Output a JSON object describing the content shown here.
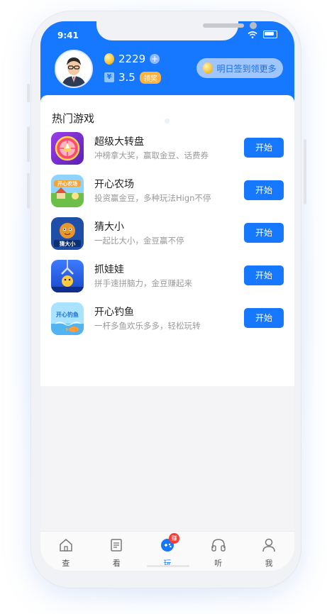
{
  "status_bar": {
    "time": "9:41"
  },
  "user": {
    "coins": "2229",
    "money": "3.5",
    "money_icon": "¥",
    "claim_label": "领奖",
    "signin_label": "明日签到领更多"
  },
  "section": {
    "title": "热门游戏"
  },
  "start_label": "开始",
  "games": [
    {
      "name": "超级大转盘",
      "desc": "冲榜拿大奖，赢取金豆、话费券"
    },
    {
      "name": "开心农场",
      "desc": "投资赢金豆，多种玩法Hign不停",
      "icon_text": "开心农场"
    },
    {
      "name": "猜大小",
      "desc": "一起比大小，金豆赢不停",
      "icon_text": "猜大小"
    },
    {
      "name": "抓娃娃",
      "desc": "拼手速拼脑力，金豆赚起来"
    },
    {
      "name": "开心钓鱼",
      "desc": "一杆多鱼欢乐多多，轻松玩转",
      "icon_text": "开心钓鱼"
    }
  ],
  "tabbar": {
    "badge": "赚",
    "tabs": [
      {
        "label": "查",
        "icon": "home-icon"
      },
      {
        "label": "看",
        "icon": "document-icon"
      },
      {
        "label": "玩",
        "icon": "gamepad-icon"
      },
      {
        "label": "听",
        "icon": "headphones-icon"
      },
      {
        "label": "我",
        "icon": "user-icon"
      }
    ]
  },
  "colors": {
    "primary": "#1677ff",
    "badge": "#ff3b30",
    "claim": "#ffb23e"
  }
}
